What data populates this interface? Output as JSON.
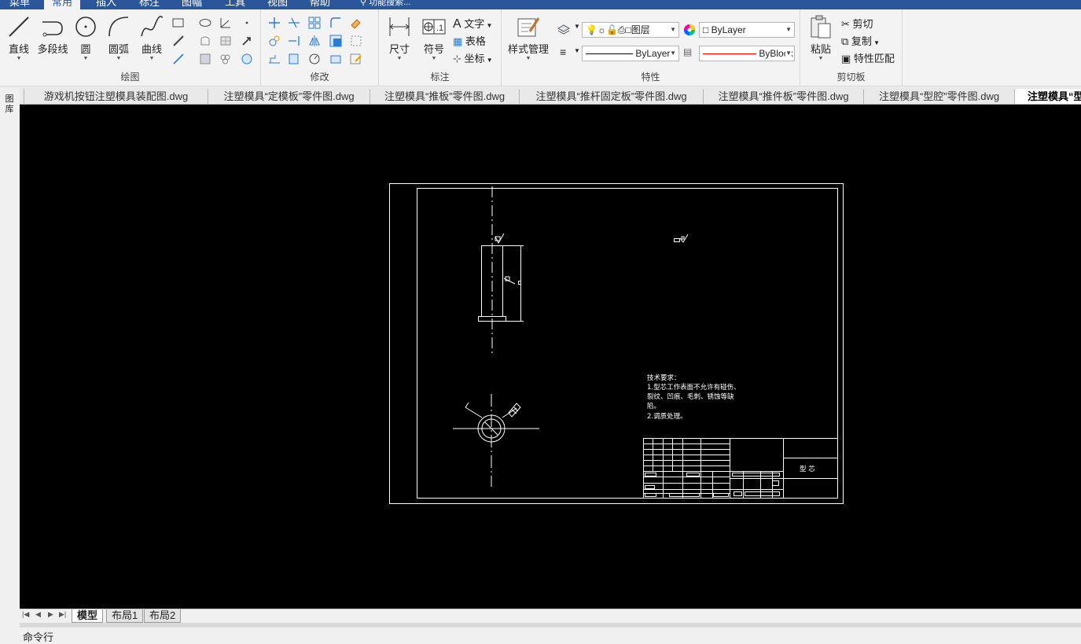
{
  "menubar": {
    "items": [
      "菜单",
      "常用",
      "插入",
      "标注",
      "图幅",
      "工具",
      "视图",
      "帮助"
    ],
    "active": "常用",
    "search_placeholder": "功能搜索..."
  },
  "ribbon": {
    "draw": {
      "label": "绘图",
      "line": "直线",
      "polyline": "多段线",
      "circle": "圆",
      "arc": "圆弧",
      "curve": "曲线"
    },
    "modify": {
      "label": "修改"
    },
    "annotate": {
      "label": "标注",
      "dimension": "尺寸",
      "symbol": "符号",
      "text": "文字",
      "table": "表格",
      "coordinate": "坐标"
    },
    "properties": {
      "label": "特性",
      "style_manager": "样式管理",
      "layer_value": "图层",
      "color_value": "ByLayer",
      "linetype_value": "ByLayer",
      "lineweight_value": "ByBlock"
    },
    "clipboard": {
      "label": "剪切板",
      "paste": "粘贴",
      "cut": "剪切",
      "copy": "复制",
      "match_props": "特性匹配"
    }
  },
  "tabs": [
    "游戏机按钮注塑模具装配图.dwg",
    "注塑模具“定模板”零件图.dwg",
    "注塑模具“推板”零件图.dwg",
    "注塑模具“推杆固定板”零件图.dwg",
    "注塑模具“推件板”零件图.dwg",
    "注塑模具“型腔”零件图.dwg",
    "注塑模具“型"
  ],
  "sidebar": {
    "label": "图库"
  },
  "drawing": {
    "tech_title": "技术要求：",
    "tech_line1": "1.型芯工作表面不允许有碰伤、",
    "tech_line2": "裂纹、凹痕、毛刺、锈蚀等缺",
    "tech_line3": "陷。",
    "tech_line4": "2.调质处理。",
    "part_name": "型 芯"
  },
  "layout_tabs": [
    "模型",
    "布局1",
    "布局2"
  ],
  "layout_active": "模型",
  "command": {
    "label": "命令行"
  },
  "colors": {
    "accent": "#2b579a",
    "canvas": "#000000",
    "linework": "#ffffff",
    "lineweight_red": "#ff0000"
  }
}
